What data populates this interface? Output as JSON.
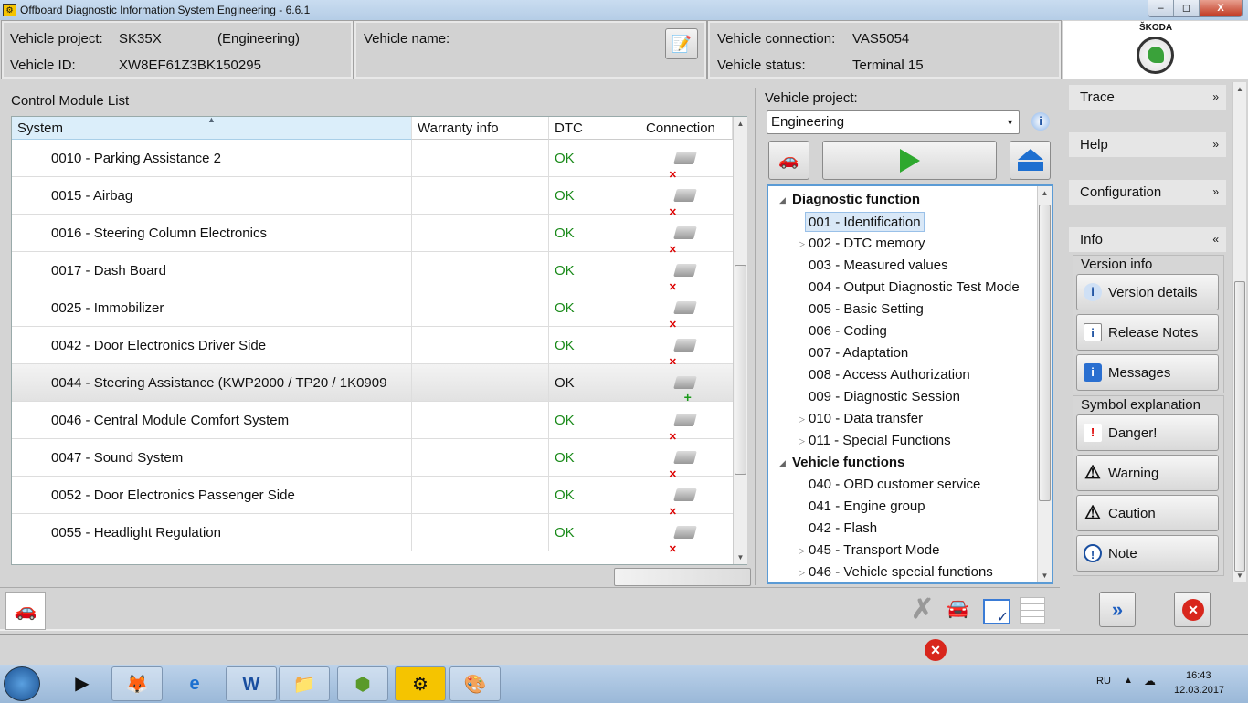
{
  "window": {
    "title": "Offboard Diagnostic Information System Engineering - 6.6.1",
    "min": "–",
    "max": "◻",
    "close": "X"
  },
  "header": {
    "vehicle_project_label": "Vehicle project:",
    "vehicle_project_value": "SK35X",
    "vehicle_project_mode": "(Engineering)",
    "vehicle_id_label": "Vehicle ID:",
    "vehicle_id_value": "XW8EF61Z3BK150295",
    "vehicle_name_label": "Vehicle name:",
    "vehicle_connection_label": "Vehicle connection:",
    "vehicle_connection_value": "VAS5054",
    "vehicle_status_label": "Vehicle status:",
    "vehicle_status_value": "Terminal 15",
    "brand": "ŠKODA"
  },
  "module_list": {
    "title": "Control Module List",
    "columns": [
      "System",
      "Warranty info",
      "DTC",
      "Connection"
    ],
    "rows": [
      {
        "system": "0010 - Parking Assistance 2",
        "dtc": "OK",
        "connection": "disconnected"
      },
      {
        "system": "0015 - Airbag",
        "dtc": "OK",
        "connection": "disconnected"
      },
      {
        "system": "0016 - Steering Column Electronics",
        "dtc": "OK",
        "connection": "disconnected"
      },
      {
        "system": "0017 - Dash Board",
        "dtc": "OK",
        "connection": "disconnected"
      },
      {
        "system": "0025 - Immobilizer",
        "dtc": "OK",
        "connection": "disconnected"
      },
      {
        "system": "0042 - Door Electronics Driver Side",
        "dtc": "OK",
        "connection": "disconnected"
      },
      {
        "system": "0044 - Steering Assistance  (KWP2000 / TP20 / 1K0909",
        "dtc": "OK",
        "connection": "connected",
        "selected": true
      },
      {
        "system": "0046 - Central Module Comfort System",
        "dtc": "OK",
        "connection": "disconnected"
      },
      {
        "system": "0047 - Sound System",
        "dtc": "OK",
        "connection": "disconnected"
      },
      {
        "system": "0052 - Door Electronics Passenger Side",
        "dtc": "OK",
        "connection": "disconnected"
      },
      {
        "system": "0055 - Headlight Regulation",
        "dtc": "OK",
        "connection": "disconnected"
      }
    ]
  },
  "middle": {
    "vehicle_project_label": "Vehicle project:",
    "vehicle_project_select": "Engineering",
    "tree": [
      {
        "label": "Diagnostic function",
        "level": 0,
        "header": true,
        "expanded": true
      },
      {
        "label": "001 - Identification",
        "level": 1,
        "selected": true
      },
      {
        "label": "002 - DTC memory",
        "level": 1,
        "expandable": true
      },
      {
        "label": "003 - Measured values",
        "level": 1
      },
      {
        "label": "004 - Output Diagnostic Test Mode",
        "level": 1
      },
      {
        "label": "005 - Basic Setting",
        "level": 1
      },
      {
        "label": "006 - Coding",
        "level": 1
      },
      {
        "label": "007 - Adaptation",
        "level": 1
      },
      {
        "label": "008 - Access Authorization",
        "level": 1
      },
      {
        "label": "009 - Diagnostic Session",
        "level": 1
      },
      {
        "label": "010 - Data transfer",
        "level": 1,
        "expandable": true
      },
      {
        "label": "011 - Special Functions",
        "level": 1,
        "expandable": true
      },
      {
        "label": "Vehicle functions",
        "level": 0,
        "header": true,
        "expanded": true
      },
      {
        "label": "040 - OBD customer service",
        "level": 1
      },
      {
        "label": "041 - Engine group",
        "level": 1
      },
      {
        "label": "042 - Flash",
        "level": 1
      },
      {
        "label": "045 - Transport Mode",
        "level": 1,
        "expandable": true
      },
      {
        "label": "046 - Vehicle special functions",
        "level": 1,
        "expandable": true
      }
    ]
  },
  "side": {
    "trace": "Trace",
    "help": "Help",
    "configuration": "Configuration",
    "info": "Info",
    "version_info": "Version info",
    "version_details": "Version details",
    "release_notes": "Release Notes",
    "messages": "Messages",
    "symbol_explanation": "Symbol explanation",
    "danger": "Danger!",
    "warning": "Warning",
    "caution": "Caution",
    "note": "Note"
  },
  "taskbar": {
    "lang": "RU",
    "time": "16:43",
    "date": "12.03.2017"
  },
  "colors": {
    "ok": "#1a8a1a",
    "tree_border": "#5b9bd5",
    "brand_green": "#3aa23a"
  }
}
